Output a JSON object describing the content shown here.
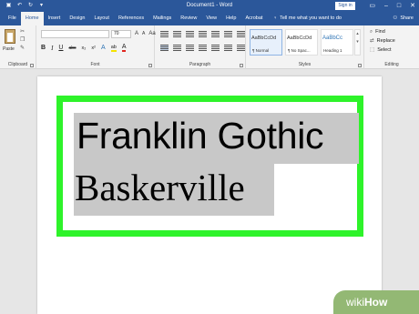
{
  "window": {
    "title": "Document1 - Word",
    "sign_in": "Sign in",
    "qat_icons": [
      "save-icon",
      "undo-icon",
      "redo-icon",
      "customize-icon"
    ],
    "controls": [
      "minimize-icon",
      "maximize-icon",
      "close-icon"
    ]
  },
  "tabs": [
    "File",
    "Home",
    "Insert",
    "Design",
    "Layout",
    "References",
    "Mailings",
    "Review",
    "View",
    "Help",
    "Acrobat"
  ],
  "active_tab": "Home",
  "tell_me": "Tell me what you want to do",
  "share": "Share",
  "ribbon": {
    "clipboard": {
      "label": "Clipboard",
      "paste": "Paste"
    },
    "font": {
      "label": "Font",
      "size": "70",
      "grow": "A",
      "shrink": "A",
      "aa": "Aa",
      "bold": "B",
      "italic": "I",
      "underline": "U",
      "strike": "abc",
      "subscript": "x₂",
      "superscript": "x²",
      "effects": "A",
      "highlight": "ab",
      "color": "A"
    },
    "paragraph": {
      "label": "Paragraph"
    },
    "styles": {
      "label": "Styles",
      "items": [
        {
          "preview": "AaBbCcDd",
          "name": "¶ Normal"
        },
        {
          "preview": "AaBbCcDd",
          "name": "¶ No Spac..."
        },
        {
          "preview": "AaBbCc",
          "name": "Heading 1"
        }
      ]
    },
    "editing": {
      "label": "Editing",
      "find": "Find",
      "replace": "Replace",
      "select": "Select"
    }
  },
  "document": {
    "line1": "Franklin Gothic",
    "line2": "Baskerville"
  },
  "watermark": {
    "wiki": "wiki",
    "how": "How"
  },
  "colors": {
    "word_blue": "#2b579a",
    "highlight_box": "#2ef32a",
    "selection_gray": "#c8c8c8",
    "watermark_green": "#93b874"
  }
}
